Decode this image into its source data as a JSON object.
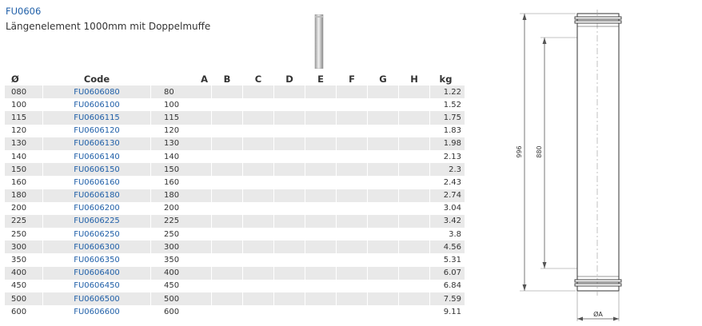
{
  "header": {
    "code": "FU0606",
    "subtitle": "Längenelement 1000mm mit Doppelmuffe"
  },
  "table": {
    "columns": [
      "Ø",
      "Code",
      "A",
      "B",
      "C",
      "D",
      "E",
      "F",
      "G",
      "H",
      "kg"
    ],
    "rows": [
      {
        "d": "080",
        "code": "FU0606080",
        "a": "80",
        "kg": "1.22"
      },
      {
        "d": "100",
        "code": "FU0606100",
        "a": "100",
        "kg": "1.52"
      },
      {
        "d": "115",
        "code": "FU0606115",
        "a": "115",
        "kg": "1.75"
      },
      {
        "d": "120",
        "code": "FU0606120",
        "a": "120",
        "kg": "1.83"
      },
      {
        "d": "130",
        "code": "FU0606130",
        "a": "130",
        "kg": "1.98"
      },
      {
        "d": "140",
        "code": "FU0606140",
        "a": "140",
        "kg": "2.13"
      },
      {
        "d": "150",
        "code": "FU0606150",
        "a": "150",
        "kg": "2.3"
      },
      {
        "d": "160",
        "code": "FU0606160",
        "a": "160",
        "kg": "2.43"
      },
      {
        "d": "180",
        "code": "FU0606180",
        "a": "180",
        "kg": "2.74"
      },
      {
        "d": "200",
        "code": "FU0606200",
        "a": "200",
        "kg": "3.04"
      },
      {
        "d": "225",
        "code": "FU0606225",
        "a": "225",
        "kg": "3.42"
      },
      {
        "d": "250",
        "code": "FU0606250",
        "a": "250",
        "kg": "3.8"
      },
      {
        "d": "300",
        "code": "FU0606300",
        "a": "300",
        "kg": "4.56"
      },
      {
        "d": "350",
        "code": "FU0606350",
        "a": "350",
        "kg": "5.31"
      },
      {
        "d": "400",
        "code": "FU0606400",
        "a": "400",
        "kg": "6.07"
      },
      {
        "d": "450",
        "code": "FU0606450",
        "a": "450",
        "kg": "6.84"
      },
      {
        "d": "500",
        "code": "FU0606500",
        "a": "500",
        "kg": "7.59"
      },
      {
        "d": "600",
        "code": "FU0606600",
        "a": "600",
        "kg": "9.11"
      }
    ]
  },
  "drawing": {
    "overall_length": "996",
    "inner_length": "880",
    "diameter_label": "ØA"
  },
  "colors": {
    "link": "#1f5fa8",
    "row_stripe": "#e9e9e9"
  }
}
